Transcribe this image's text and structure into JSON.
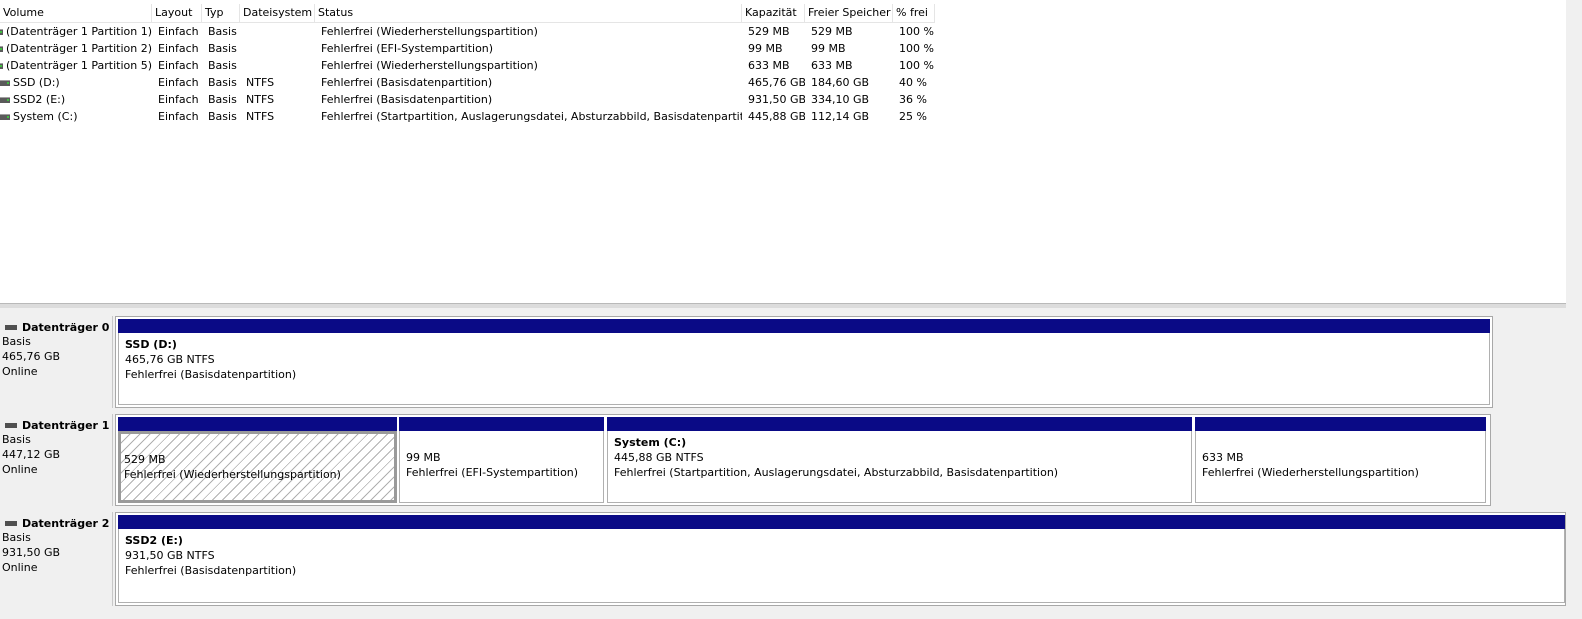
{
  "volume_list": {
    "columns": [
      {
        "label": "Volume",
        "width": 152
      },
      {
        "label": "Layout",
        "width": 50
      },
      {
        "label": "Typ",
        "width": 38
      },
      {
        "label": "Dateisystem",
        "width": 75
      },
      {
        "label": "Status",
        "width": 427
      },
      {
        "label": "Kapazität",
        "width": 63
      },
      {
        "label": "Freier Speicher",
        "width": 88
      },
      {
        "label": "% frei",
        "width": 42
      }
    ],
    "rows": [
      [
        "(Datenträger 1 Partition 1)",
        "Einfach",
        "Basis",
        "",
        "Fehlerfrei (Wiederherstellungspartition)",
        "529 MB",
        "529 MB",
        "100 %"
      ],
      [
        "(Datenträger 1 Partition 2)",
        "Einfach",
        "Basis",
        "",
        "Fehlerfrei (EFI-Systempartition)",
        "99 MB",
        "99 MB",
        "100 %"
      ],
      [
        "(Datenträger 1 Partition 5)",
        "Einfach",
        "Basis",
        "",
        "Fehlerfrei (Wiederherstellungspartition)",
        "633 MB",
        "633 MB",
        "100 %"
      ],
      [
        "SSD (D:)",
        "Einfach",
        "Basis",
        "NTFS",
        "Fehlerfrei (Basisdatenpartition)",
        "465,76 GB",
        "184,60 GB",
        "40 %"
      ],
      [
        "SSD2 (E:)",
        "Einfach",
        "Basis",
        "NTFS",
        "Fehlerfrei (Basisdatenpartition)",
        "931,50 GB",
        "334,10 GB",
        "36 %"
      ],
      [
        "System (C:)",
        "Einfach",
        "Basis",
        "NTFS",
        "Fehlerfrei (Startpartition, Auslagerungsdatei, Absturzabbild, Basisdatenpartition)",
        "445,88 GB",
        "112,14 GB",
        "25 %"
      ]
    ]
  },
  "disks": [
    {
      "name": "Datenträger 0",
      "type": "Basis",
      "size": "465,76 GB",
      "state": "Online",
      "partitions": [
        {
          "name": "SSD  (D:)",
          "size": "465,76 GB NTFS",
          "status": "Fehlerfrei (Basisdatenpartition)",
          "hatched": false
        }
      ]
    },
    {
      "name": "Datenträger 1",
      "type": "Basis",
      "size": "447,12 GB",
      "state": "Online",
      "partitions": [
        {
          "name": "",
          "size": "529 MB",
          "status": "Fehlerfrei (Wiederherstellungspartition)",
          "hatched": true
        },
        {
          "name": "",
          "size": "99 MB",
          "status": "Fehlerfrei (EFI-Systempartition)",
          "hatched": false
        },
        {
          "name": "System  (C:)",
          "size": "445,88 GB NTFS",
          "status": "Fehlerfrei (Startpartition, Auslagerungsdatei, Absturzabbild, Basisdatenpartition)",
          "hatched": false
        },
        {
          "name": "",
          "size": "633 MB",
          "status": "Fehlerfrei (Wiederherstellungspartition)",
          "hatched": false
        }
      ]
    },
    {
      "name": "Datenträger 2",
      "type": "Basis",
      "size": "931,50 GB",
      "state": "Online",
      "partitions": [
        {
          "name": "SSD2  (E:)",
          "size": "931,50 GB NTFS",
          "status": "Fehlerfrei (Basisdatenpartition)",
          "hatched": false
        }
      ]
    }
  ],
  "colors": {
    "partition_header": "#0a0a86",
    "window_bg": "#f0f0f0"
  }
}
